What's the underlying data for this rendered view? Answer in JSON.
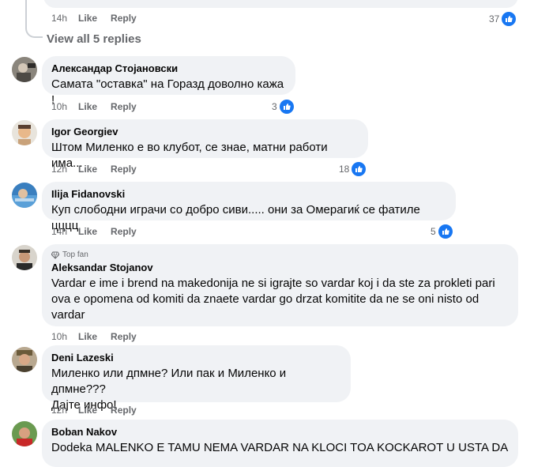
{
  "top_reply": {
    "time": "14h",
    "like_label": "Like",
    "reply_label": "Reply",
    "reaction_count": "37"
  },
  "view_all_label": "View all 5 replies",
  "comments": [
    {
      "author": "Александар Стојановски",
      "lines": [
        "Самата \"оставка\" на Горазд доволно кажа !"
      ],
      "time": "10h",
      "like_label": "Like",
      "reply_label": "Reply",
      "reaction_count": "3"
    },
    {
      "author": "Igor Georgiev",
      "lines": [
        "Штом Миленко е во клубот, се знае, матни работи има..."
      ],
      "time": "12h",
      "like_label": "Like",
      "reply_label": "Reply",
      "reaction_count": "18"
    },
    {
      "author": "Ilija Fidanovski",
      "lines": [
        "Куп слободни играчи со добро сиви..... они за Омерагиќ се фатиле цццц"
      ],
      "time": "14h",
      "like_label": "Like",
      "reply_label": "Reply",
      "reaction_count": "5"
    },
    {
      "badge": "Top fan",
      "author": "Aleksandar Stojanov",
      "lines": [
        "Vardar e ime i brend na makedonija ne si igrajte so vardar koj i da ste za prokleti pari",
        "ova e opomena od komiti da znaete vardar go drzat komitite da ne se oni nisto od",
        "vardar"
      ],
      "time": "10h",
      "like_label": "Like",
      "reply_label": "Reply"
    },
    {
      "author": "Deni Lazeski",
      "lines": [
        "Миленко или дпмне? Или пак и Миленко и дпмне???",
        "Дајте инфо!"
      ],
      "time": "12h",
      "like_label": "Like",
      "reply_label": "Reply"
    },
    {
      "author": "Boban Nakov",
      "lines": [
        "Dodeka MALENKO E TAMU NEMA VARDAR NA KLOCI TOA KOCKAROT U USTA DA GO"
      ]
    }
  ],
  "colors": {
    "bubble": "#f0f2f5",
    "meta": "#65676b",
    "like_blue": "#1877f2"
  }
}
